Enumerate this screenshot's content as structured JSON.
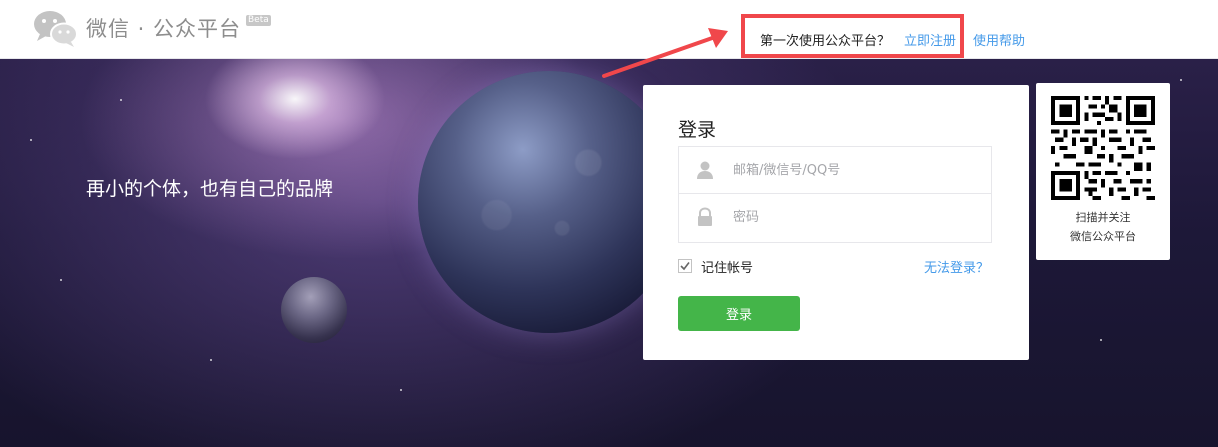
{
  "header": {
    "logo_icon": "wechat-bubbles-icon",
    "logo_text": "微信 · 公众平台",
    "beta_label": "Beta",
    "first_use_text": "第一次使用公众平台？",
    "register_link": "立即注册",
    "help_link": "使用帮助"
  },
  "banner": {
    "slogan": "再小的个体，也有自己的品牌"
  },
  "login": {
    "title": "登录",
    "username_placeholder": "邮箱/微信号/QQ号",
    "username_icon": "user-icon",
    "password_placeholder": "密码",
    "password_icon": "lock-icon",
    "remember_label": "记住帐号",
    "remember_checked": true,
    "cannot_login_link": "无法登录？",
    "submit_label": "登录"
  },
  "qr": {
    "icon": "qr-code-icon",
    "caption_line1": "扫描并关注",
    "caption_line2": "微信公众平台"
  },
  "colors": {
    "accent_green": "#44b549",
    "link_blue": "#459ae9",
    "highlight_red": "#f0474b",
    "banner_bg": "#1d1838"
  }
}
